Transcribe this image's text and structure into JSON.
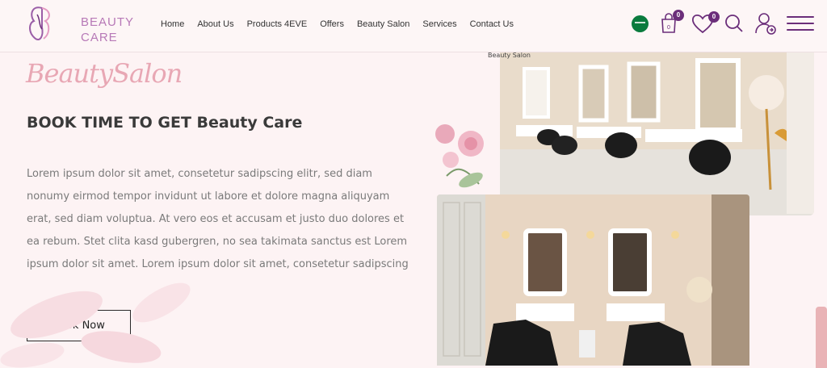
{
  "brand": {
    "line1": "BEAUTY",
    "line2": "CARE"
  },
  "nav": {
    "items": [
      {
        "label": "Home"
      },
      {
        "label": "About Us"
      },
      {
        "label": "Products 4EVE"
      },
      {
        "label": "Offers"
      },
      {
        "label": "Beauty Salon"
      },
      {
        "label": "Services"
      },
      {
        "label": "Contact Us"
      }
    ]
  },
  "header": {
    "cart_count": "0",
    "wishlist_count": "0",
    "accent_color": "#6b2e7a"
  },
  "hero": {
    "script_title": "BeautySalon",
    "title": "BOOK TIME TO GET Beauty Care",
    "description": "Lorem ipsum dolor sit amet, consetetur sadipscing elitr, sed diam nonumy eirmod tempor invidunt ut labore et dolore magna aliquyam erat, sed diam voluptua. At vero eos et accusam et justo duo dolores et ea rebum. Stet clita kasd gubergren, no sea takimata sanctus est Lorem ipsum dolor sit amet. Lorem ipsum dolor sit amet, consetetur sadipscing",
    "cta_label": "Book Now",
    "ring_text": "Beauty Salon"
  },
  "icons": [
    "butterfly-logo-icon",
    "flag-icon",
    "bag-icon",
    "heart-icon",
    "search-icon",
    "account-icon",
    "menu-icon"
  ]
}
